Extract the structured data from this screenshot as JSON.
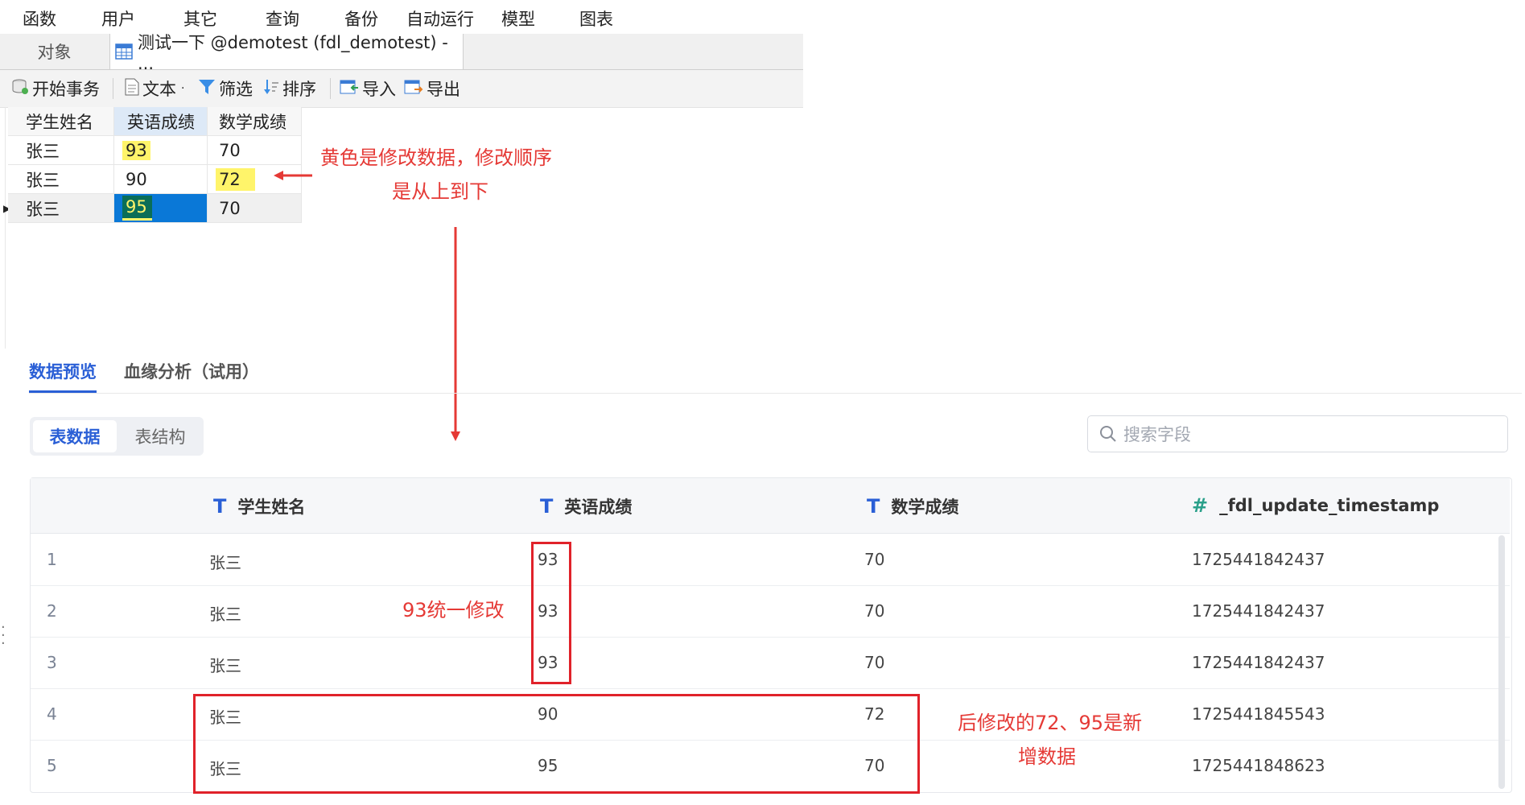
{
  "menu": [
    "函数",
    "用户",
    "其它",
    "查询",
    "备份",
    "自动运行",
    "模型",
    "图表"
  ],
  "tabs": {
    "objects": "对象",
    "active": "测试一下 @demotest (fdl_demotest) - ..."
  },
  "toolbar": {
    "begin_tx": "开始事务",
    "text": "文本",
    "filter": "筛选",
    "sort": "排序",
    "import": "导入",
    "export": "导出"
  },
  "grid": {
    "headers": [
      "学生姓名",
      "英语成绩",
      "数学成绩"
    ],
    "rows": [
      [
        "张三",
        "93",
        "70"
      ],
      [
        "张三",
        "90",
        "72"
      ],
      [
        "张三",
        "95",
        "70"
      ]
    ],
    "highlight_color": "#fff46a"
  },
  "annotations": {
    "yellow_line1": "黄色是修改数据，修改顺序",
    "yellow_line2": "是从上到下",
    "unified": "93统一修改",
    "new_line1": "后修改的72、95是新",
    "new_line2": "增数据",
    "color": "#e53935"
  },
  "panel": {
    "tab_preview": "数据预览",
    "tab_lineage": "血缘分析（试用）",
    "seg_data": "表数据",
    "seg_struct": "表结构",
    "search_placeholder": "搜索字段",
    "accent": "#2a5fd6"
  },
  "table": {
    "columns": [
      {
        "type_icon": "T",
        "name": "学生姓名"
      },
      {
        "type_icon": "T",
        "name": "英语成绩"
      },
      {
        "type_icon": "T",
        "name": "数学成绩"
      },
      {
        "type_icon": "#",
        "name": "_fdl_update_timestamp"
      }
    ],
    "rows": [
      [
        "1",
        "张三",
        "93",
        "70",
        "1725441842437"
      ],
      [
        "2",
        "张三",
        "93",
        "70",
        "1725441842437"
      ],
      [
        "3",
        "张三",
        "93",
        "70",
        "1725441842437"
      ],
      [
        "4",
        "张三",
        "90",
        "72",
        "1725441845543"
      ],
      [
        "5",
        "张三",
        "95",
        "70",
        "1725441848623"
      ]
    ]
  }
}
